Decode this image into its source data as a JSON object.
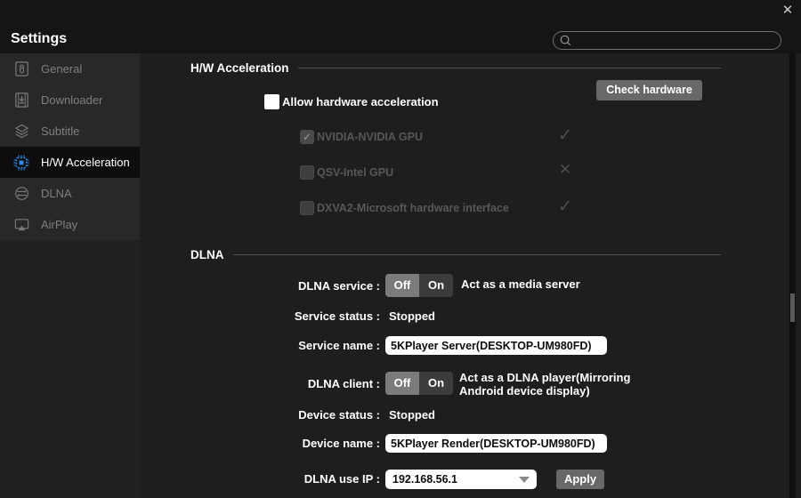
{
  "window": {
    "title": "Settings",
    "close_glyph": "✕"
  },
  "search": {
    "value": "",
    "placeholder": ""
  },
  "sidebar": {
    "items": [
      {
        "label": "General",
        "selected": false
      },
      {
        "label": "Downloader",
        "selected": false
      },
      {
        "label": "Subtitle",
        "selected": false
      },
      {
        "label": "H/W Acceleration",
        "selected": true
      },
      {
        "label": "DLNA",
        "selected": false
      },
      {
        "label": "AirPlay",
        "selected": false
      }
    ]
  },
  "hw_section": {
    "title": "H/W Acceleration",
    "check_hardware_button": "Check hardware",
    "allow_checkbox_label": "Allow hardware acceleration",
    "allow_checked": false,
    "gpu_options": [
      {
        "label": "NVIDIA-NVIDIA GPU",
        "box_glyph": "✓",
        "status_glyph": "✓",
        "status": "supported"
      },
      {
        "label": "QSV-Intel GPU",
        "box_glyph": "",
        "status_glyph": "✕",
        "status": "unsupported"
      },
      {
        "label": "DXVA2-Microsoft hardware interface",
        "box_glyph": "",
        "status_glyph": "✓",
        "status": "supported"
      }
    ]
  },
  "dlna_section": {
    "title": "DLNA",
    "service": {
      "label": "DLNA service :",
      "off": "Off",
      "on": "On",
      "state": "Off",
      "desc": "Act as a media server"
    },
    "service_status": {
      "label": "Service status :",
      "value": "Stopped"
    },
    "service_name": {
      "label": "Service name :",
      "value": "5KPlayer Server(DESKTOP-UM980FD)"
    },
    "client": {
      "label": "DLNA client :",
      "off": "Off",
      "on": "On",
      "state": "Off",
      "desc_line1": "Act as a DLNA player(Mirroring",
      "desc_line2": "Android device display)"
    },
    "device_status": {
      "label": "Device status :",
      "value": "Stopped"
    },
    "device_name": {
      "label": "Device name :",
      "value": "5KPlayer Render(DESKTOP-UM980FD)"
    },
    "use_ip": {
      "label": "DLNA use IP :",
      "value": "192.168.56.1",
      "apply_button": "Apply"
    }
  },
  "colors": {
    "accent_blue": "#2b8ceb",
    "topbar_bg": "#151515",
    "sidebar_bg": "#282828",
    "selected_item_bg": "#0d0d0d",
    "content_bg": "#1e1e1e",
    "button_bg": "#686868",
    "toggle_off_bg": "#7b7b7b",
    "toggle_on_bg": "#3c3c3c",
    "disabled_text": "#575757"
  }
}
